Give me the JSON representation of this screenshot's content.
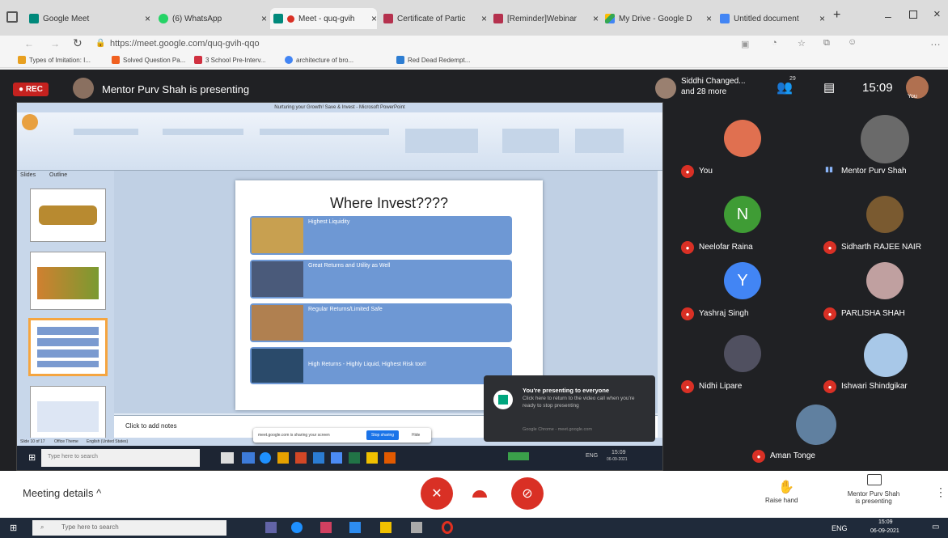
{
  "tabs": [
    {
      "label": "Google Meet"
    },
    {
      "label": "(6) WhatsApp"
    },
    {
      "label": "Meet - quq-gvih"
    },
    {
      "label": "Certificate of Partic"
    },
    {
      "label": "[Reminder]Webinar"
    },
    {
      "label": "My Drive - Google D"
    },
    {
      "label": "Untitled document"
    }
  ],
  "address": "https://meet.google.com/quq-gvih-qqo",
  "bookmarks": [
    "Types of Imitation: I...",
    "Solved Question Pa...",
    "3 School Pre-Interv...",
    "architecture of bro...",
    "Red Dead Redempt..."
  ],
  "meet": {
    "rec": "REC",
    "presenter_title": "Mentor Purv Shah is presenting",
    "others": "Siddhi Changed...",
    "others2": "and 28 more",
    "count_badge": "29",
    "time": "15:09",
    "you": "You",
    "meeting_details": "Meeting details",
    "raise_hand": "Raise hand",
    "presenting_line1": "Mentor Purv Shah",
    "presenting_line2": "is presenting"
  },
  "ppt": {
    "window_title": "Nurturing your Growth! Save & Invest - Microsoft PowerPoint",
    "slide_title": "Where Invest????",
    "rows": [
      {
        "head": "Highest Liquidity",
        "color": "#c8a050"
      },
      {
        "head": "Great Returns and Utility as Well",
        "color": "#4a5a7a"
      },
      {
        "head": "Regular Returns/Limited Safe",
        "color": "#b08050"
      },
      {
        "head": "High Returns - Highly Liquid, Highest Risk too!!",
        "color": "#2a4a6a"
      }
    ],
    "notes": "Click to add notes",
    "slide_status": "Slide 10 of 17",
    "office_theme": "Office Theme",
    "lang": "English (United States)",
    "tabs": [
      "Slides",
      "Outline"
    ],
    "share_bar": "meet.google.com is sharing your screen",
    "stop_sharing": "Stop sharing",
    "hide": "Hide",
    "toast_title": "You're presenting to everyone",
    "toast_body": "Click here to return to the video call when you're ready to stop presenting",
    "toast_src": "Google Chrome - meet.google.com",
    "inner_search": "Type here to search"
  },
  "participants": [
    {
      "name": "You",
      "letter": "",
      "color": "#e07050"
    },
    {
      "name": "Mentor Purv Shah",
      "letter": "",
      "color": "#6a6a6a"
    },
    {
      "name": "Neelofar Raina",
      "letter": "N",
      "color": "#3f9c35"
    },
    {
      "name": "Sidharth RAJEE NAIR",
      "letter": "",
      "color": "#7a5a30"
    },
    {
      "name": "Yashraj Singh",
      "letter": "Y",
      "color": "#4285f4"
    },
    {
      "name": "PARLISHA SHAH",
      "letter": "",
      "color": "#c0a0a0"
    },
    {
      "name": "Nidhi Lipare",
      "letter": "",
      "color": "#505060"
    },
    {
      "name": "Ishwari Shindgikar",
      "letter": "",
      "color": "#a8c8e8"
    },
    {
      "name": "Aman Tonge",
      "letter": "",
      "color": "#6080a0"
    }
  ],
  "taskbar": {
    "search": "Type here to search",
    "lang": "ENG",
    "time": "15:09",
    "date": "06-09-2021"
  },
  "colors": {
    "meet_red": "#d93025",
    "stage": "#202124",
    "tile": "#3c4043"
  }
}
